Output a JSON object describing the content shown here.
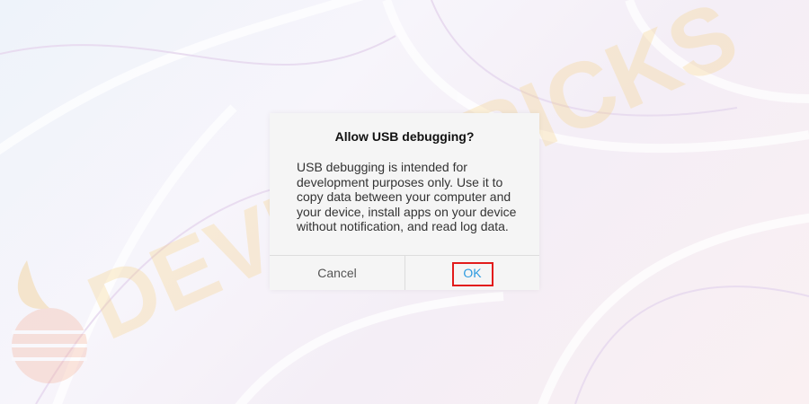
{
  "dialog": {
    "title": "Allow USB debugging?",
    "message": "USB debugging is intended for development purposes only. Use it to copy data between your computer and your device, install apps on your device without notification, and read log data.",
    "cancel_label": "Cancel",
    "ok_label": "OK"
  },
  "watermark": {
    "text": "DEVICETRICKS"
  },
  "colors": {
    "ok_text": "#2d9be0",
    "highlight_border": "#e21b1b",
    "watermark": "#f7cf7a"
  }
}
